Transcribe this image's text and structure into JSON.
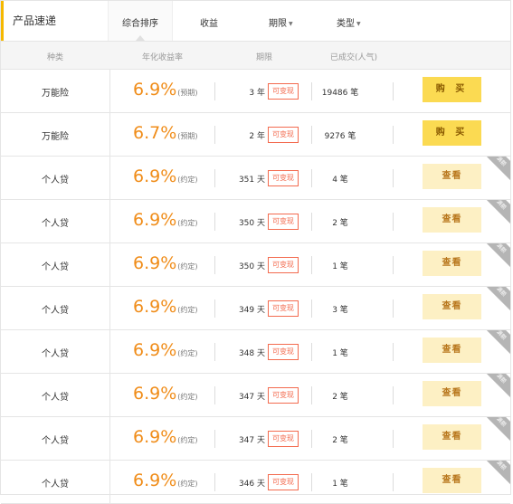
{
  "header": {
    "title": "产品速递",
    "tabs": [
      {
        "label": "综合排序",
        "active": true,
        "dropdown": false
      },
      {
        "label": "收益",
        "active": false,
        "dropdown": false
      },
      {
        "label": "期限",
        "active": false,
        "dropdown": true
      },
      {
        "label": "类型",
        "active": false,
        "dropdown": true
      }
    ]
  },
  "columns": {
    "kind": "种类",
    "rate": "年化收益率",
    "term": "期限",
    "sold": "已成交(人气)"
  },
  "colors": {
    "accent": "#f5b800",
    "rate": "#f08d1a",
    "tag": "#f36b4f",
    "buy_button": "#fbda52",
    "view_button": "#fdf0c4"
  },
  "rows": [
    {
      "kind": "万能险",
      "rate": "6.9%",
      "rate_note": "(预期)",
      "term": "3 年",
      "tag": "可变现",
      "count": "19486 笔",
      "button": "购 买",
      "button_type": "buy",
      "corner": ""
    },
    {
      "kind": "万能险",
      "rate": "6.7%",
      "rate_note": "(预期)",
      "term": "2 年",
      "tag": "可变现",
      "count": "9276 笔",
      "button": "购 买",
      "button_type": "buy",
      "corner": ""
    },
    {
      "kind": "个人贷",
      "rate": "6.9%",
      "rate_note": "(约定)",
      "term": "351 天",
      "tag": "可变现",
      "count": "4 笔",
      "button": "查看",
      "button_type": "view",
      "corner": "满额"
    },
    {
      "kind": "个人贷",
      "rate": "6.9%",
      "rate_note": "(约定)",
      "term": "350 天",
      "tag": "可变现",
      "count": "2 笔",
      "button": "查看",
      "button_type": "view",
      "corner": "满额"
    },
    {
      "kind": "个人贷",
      "rate": "6.9%",
      "rate_note": "(约定)",
      "term": "350 天",
      "tag": "可变现",
      "count": "1 笔",
      "button": "查看",
      "button_type": "view",
      "corner": "满额"
    },
    {
      "kind": "个人贷",
      "rate": "6.9%",
      "rate_note": "(约定)",
      "term": "349 天",
      "tag": "可变现",
      "count": "3 笔",
      "button": "查看",
      "button_type": "view",
      "corner": "满额"
    },
    {
      "kind": "个人贷",
      "rate": "6.9%",
      "rate_note": "(约定)",
      "term": "348 天",
      "tag": "可变现",
      "count": "1 笔",
      "button": "查看",
      "button_type": "view",
      "corner": "满额"
    },
    {
      "kind": "个人贷",
      "rate": "6.9%",
      "rate_note": "(约定)",
      "term": "347 天",
      "tag": "可变现",
      "count": "2 笔",
      "button": "查看",
      "button_type": "view",
      "corner": "满额"
    },
    {
      "kind": "个人贷",
      "rate": "6.9%",
      "rate_note": "(约定)",
      "term": "347 天",
      "tag": "可变现",
      "count": "2 笔",
      "button": "查看",
      "button_type": "view",
      "corner": "满额"
    },
    {
      "kind": "个人贷",
      "rate": "6.9%",
      "rate_note": "(约定)",
      "term": "346 天",
      "tag": "可变现",
      "count": "1 笔",
      "button": "查看",
      "button_type": "view",
      "corner": "满额"
    }
  ]
}
